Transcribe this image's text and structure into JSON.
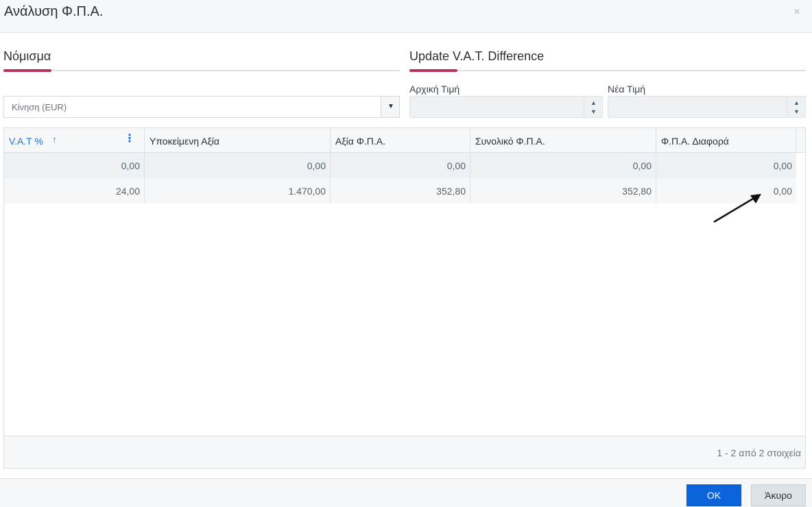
{
  "dialog": {
    "title": "Ανάλυση Φ.Π.Α.",
    "close_icon": "×"
  },
  "currency_section": {
    "title": "Νόμισμα",
    "select_value": "Κίνηση (EUR)",
    "dropdown_icon": "▼",
    "accent_color": "#b5325e"
  },
  "vat_update_section": {
    "title": "Update V.A.T. Difference",
    "initial_value_label": "Αρχική Τιμή",
    "initial_value": "",
    "new_value_label": "Νέα Τιμή",
    "new_value": "",
    "spin_up_icon": "▲",
    "spin_down_icon": "▼"
  },
  "grid": {
    "columns": [
      {
        "label": "V.A.T %",
        "sorted": "ascending"
      },
      {
        "label": "Υποκείμενη Αξία"
      },
      {
        "label": "Αξία Φ.Π.Α."
      },
      {
        "label": "Συνολικό Φ.Π.Α."
      },
      {
        "label": "Φ.Π.Α. Διαφορά"
      }
    ],
    "sort_icon": "↑",
    "column_menu_icon": "⋮",
    "rows": [
      [
        "0,00",
        "0,00",
        "0,00",
        "0,00",
        "0,00"
      ],
      [
        "24,00",
        "1.470,00",
        "352,80",
        "352,80",
        "0,00"
      ]
    ],
    "pager_info": "1 - 2 από 2 στοιχεία"
  },
  "footer": {
    "ok_label": "OK",
    "cancel_label": "Άκυρο",
    "ok_color": "#0d63d9"
  }
}
